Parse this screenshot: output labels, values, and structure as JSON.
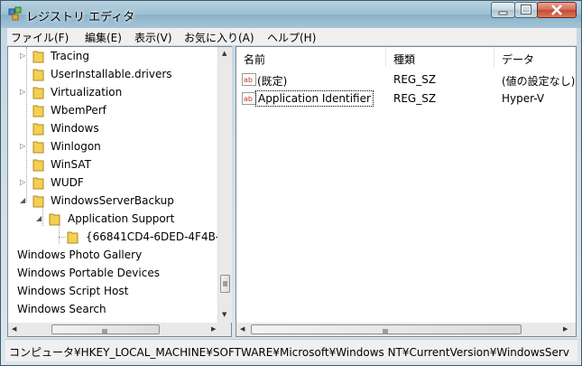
{
  "window": {
    "title": "レジストリ エディタ"
  },
  "menu": [
    {
      "label": "ファイル(F)"
    },
    {
      "label": "編集(E)"
    },
    {
      "label": "表示(V)"
    },
    {
      "label": "お気に入り(A)"
    },
    {
      "label": "ヘルプ(H)"
    }
  ],
  "tree": {
    "items": [
      {
        "label": "Tracing"
      },
      {
        "label": "UserInstallable.drivers"
      },
      {
        "label": "Virtualization"
      },
      {
        "label": "WbemPerf"
      },
      {
        "label": "Windows"
      },
      {
        "label": "Winlogon"
      },
      {
        "label": "WinSAT"
      },
      {
        "label": "WUDF"
      },
      {
        "label": "WindowsServerBackup"
      },
      {
        "label": "Application Support"
      },
      {
        "label": "{66841CD4-6DED-4F4B-8"
      },
      {
        "label": "Windows Photo Gallery"
      },
      {
        "label": "Windows Portable Devices"
      },
      {
        "label": "Windows Script Host"
      },
      {
        "label": "Windows Search"
      }
    ]
  },
  "list": {
    "columns": {
      "name": "名前",
      "type": "種類",
      "data": "データ"
    },
    "rows": [
      {
        "icon": "string-value-icon",
        "name": "(既定)",
        "type": "REG_SZ",
        "data": "(値の設定なし)"
      },
      {
        "icon": "string-value-icon",
        "name": "Application Identifier",
        "type": "REG_SZ",
        "data": "Hyper-V"
      }
    ]
  },
  "status": {
    "path": "コンピュータ¥HKEY_LOCAL_MACHINE¥SOFTWARE¥Microsoft¥Windows NT¥CurrentVersion¥WindowsServ"
  },
  "colors": {
    "folder": "#f3cf52",
    "selection_focus": "#000000",
    "frame": "#9cbfd3"
  }
}
